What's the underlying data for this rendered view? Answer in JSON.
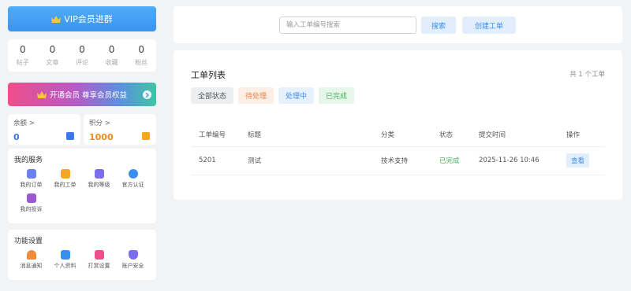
{
  "sidebar": {
    "vip_join_label": "VIP会员进群",
    "stats": [
      {
        "value": "0",
        "label": "帖子"
      },
      {
        "value": "0",
        "label": "文章"
      },
      {
        "value": "0",
        "label": "评论"
      },
      {
        "value": "0",
        "label": "收藏"
      },
      {
        "value": "0",
        "label": "粉丝"
      }
    ],
    "vip_open_label": "开通会员 尊享会员权益",
    "balance": {
      "label": "余额 >",
      "value": "0"
    },
    "points": {
      "label": "积分 >",
      "value": "1000"
    },
    "services": {
      "title": "我的服务",
      "items": [
        {
          "label": "我的订单",
          "icon": "clipboard-icon"
        },
        {
          "label": "我的工单",
          "icon": "ticket-icon"
        },
        {
          "label": "我的等级",
          "icon": "level-chart-icon"
        },
        {
          "label": "官方认证",
          "icon": "verified-icon"
        },
        {
          "label": "我的投诉",
          "icon": "complaint-icon"
        }
      ]
    },
    "settings": {
      "title": "功能设置",
      "items": [
        {
          "label": "消息通知",
          "icon": "bell-icon"
        },
        {
          "label": "个人资料",
          "icon": "profile-icon"
        },
        {
          "label": "打赏设置",
          "icon": "gift-icon"
        },
        {
          "label": "账户安全",
          "icon": "shield-icon"
        }
      ]
    }
  },
  "search": {
    "placeholder": "输入工单编号搜索",
    "search_label": "搜索",
    "create_label": "创建工单"
  },
  "tickets": {
    "title": "工单列表",
    "count": "共 1 个工单",
    "filters": [
      "全部状态",
      "待处理",
      "处理中",
      "已完成"
    ],
    "columns": [
      "工单编号",
      "标题",
      "分类",
      "状态",
      "提交时间",
      "操作"
    ],
    "rows": [
      {
        "id": "5201",
        "title": "测试",
        "category": "技术支持",
        "status": "已完成",
        "time": "2025-11-26 10:46",
        "action": "查看"
      }
    ]
  },
  "colors": {
    "accent": "#3a8ef0",
    "balance": "#3a7ae0",
    "points": "#f08a1c",
    "success": "#49b35c",
    "pending": "#e88444"
  }
}
